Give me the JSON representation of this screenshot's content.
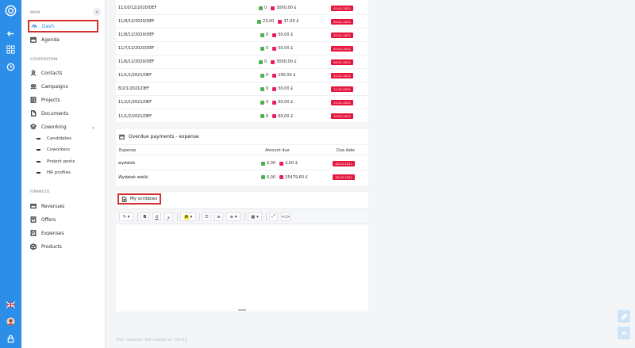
{
  "sidebar": {
    "sections": [
      {
        "title": "MAIN"
      },
      {
        "title": "COOPERATION"
      },
      {
        "title": "FINANCES"
      }
    ],
    "items": {
      "dash": "Dash",
      "agenda": "Agenda",
      "contacts": "Contacts",
      "campaigns": "Campaigns",
      "projects": "Projects",
      "documents": "Documents",
      "coworking": "Coworking",
      "candidates": "Candidates",
      "coworkers": "Coworkers",
      "project_posts": "Project posts",
      "hr_profiles": "HR profiles",
      "revenues": "Revenues",
      "offers": "Offers",
      "expenses": "Expenses",
      "products": "Products"
    }
  },
  "income_rows": [
    {
      "name": "11/10/12/2020/DEF",
      "paid": "0",
      "due": "3000,00 £",
      "date": "05-01-2021"
    },
    {
      "name": "11/9/12/2020/DEF",
      "paid": "23,00",
      "due": "37,00 £",
      "date": "05-01-2021"
    },
    {
      "name": "11/8/12/2020/DEF",
      "paid": "0",
      "due": "50,00 £",
      "date": "05-01-2021"
    },
    {
      "name": "11/7/12/2020/DEF",
      "paid": "0",
      "due": "50,00 £",
      "date": "05-01-2021"
    },
    {
      "name": "11/6/12/2020/DEF",
      "paid": "0",
      "due": "3000,00 £",
      "date": "08-01-2021"
    },
    {
      "name": "11/1/1/2021/DEF",
      "paid": "0",
      "due": "240,00 £",
      "date": "31-01-2021"
    },
    {
      "name": "8/2/1/2021/DEF",
      "paid": "0",
      "due": "50,00 £",
      "date": "11-02-2021"
    },
    {
      "name": "11/2/1/2021/DEF",
      "paid": "0",
      "due": "60,00 £",
      "date": "11-02-2021"
    },
    {
      "name": "11/1/2/2021/DEF",
      "paid": "0",
      "due": "60,00 £",
      "date": "18-02-2021"
    }
  ],
  "overdue": {
    "title": "Overdue payments - expense",
    "headers": {
      "expense": "Expense",
      "amount": "Amount due",
      "date": "Due date"
    },
    "rows": [
      {
        "name": "wydatek",
        "paid": "0,00",
        "due": "2,00 £",
        "date": "18-02-2021"
      },
      {
        "name": "Wydatek wielki",
        "paid": "0,00",
        "due": "25479,60 £",
        "date": "18-02-2021"
      }
    ]
  },
  "scribbles": {
    "title": "My scribbles"
  },
  "session_text": "Your session will expire in: 59:53",
  "colors": {
    "accent": "#2d8eea",
    "badge": "#e5173f",
    "highlight": "#d32f2f"
  }
}
